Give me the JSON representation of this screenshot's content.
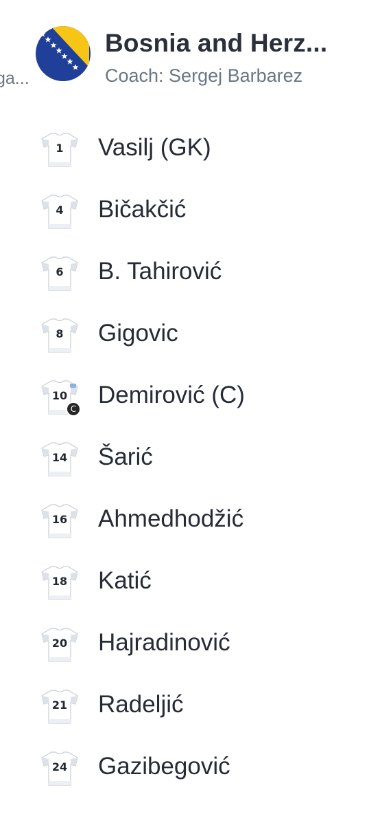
{
  "left_team": {
    "truncated_text": "ga..."
  },
  "team": {
    "name": "Bosnia and Herz...",
    "coach": "Coach: Sergej Barbarez",
    "flag_icon": "bosnia-herzegovina-flag-icon",
    "flag_colors": {
      "blue": "#1f3f99",
      "yellow": "#f6c516",
      "stars": "#ffffff"
    }
  },
  "players": [
    {
      "number": "1",
      "name": "Vasilj (GK)"
    },
    {
      "number": "4",
      "name": "Bičakčić"
    },
    {
      "number": "6",
      "name": "B. Tahirović"
    },
    {
      "number": "8",
      "name": "Gigovic"
    },
    {
      "number": "10",
      "name": "Demirović (C)",
      "captain": true,
      "captain_badge": "C"
    },
    {
      "number": "14",
      "name": "Šarić"
    },
    {
      "number": "16",
      "name": "Ahmedhodžić"
    },
    {
      "number": "18",
      "name": "Katić"
    },
    {
      "number": "20",
      "name": "Hajradinović"
    },
    {
      "number": "21",
      "name": "Radeljić"
    },
    {
      "number": "24",
      "name": "Gazibegović"
    }
  ],
  "jersey_colors": {
    "body": "#ffffff",
    "shade": "#dde1e8",
    "outline": "#c9ced6",
    "captain_stripe": "#8ab0e6"
  }
}
